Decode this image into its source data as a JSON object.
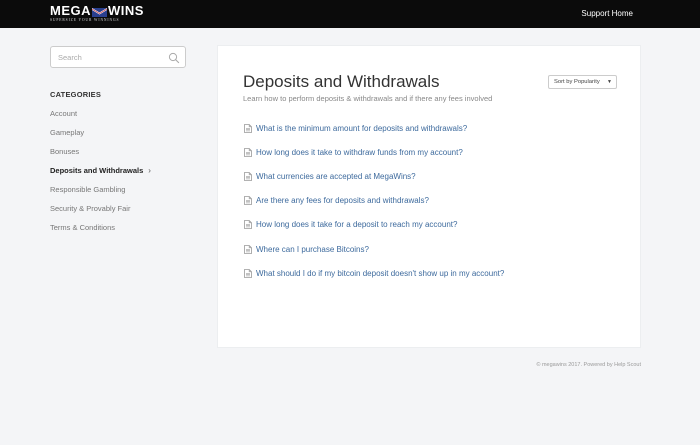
{
  "header": {
    "logo_left": "MEGA",
    "logo_right": "WINS",
    "logo_tagline": "SUPERSIZE YOUR WINNINGS",
    "support_link": "Support Home"
  },
  "sidebar": {
    "search_placeholder": "Search",
    "categories_heading": "CATEGORIES",
    "items": [
      {
        "label": "Account",
        "active": false
      },
      {
        "label": "Gameplay",
        "active": false
      },
      {
        "label": "Bonuses",
        "active": false
      },
      {
        "label": "Deposits and Withdrawals",
        "active": true
      },
      {
        "label": "Responsible Gambling",
        "active": false
      },
      {
        "label": "Security & Provably Fair",
        "active": false
      },
      {
        "label": "Terms & Conditions",
        "active": false
      }
    ]
  },
  "main": {
    "title": "Deposits and Withdrawals",
    "subtitle": "Learn how to perform deposits & withdrawals and if there any fees involved",
    "sort_label": "Sort by Popularity",
    "articles": [
      "What is the minimum amount for deposits and withdrawals?",
      "How long does it take to withdraw funds from my account?",
      "What currencies are accepted at MegaWins?",
      "Are there any fees for deposits and withdrawals?",
      "How long does it take for a deposit to reach my account?",
      "Where can I purchase Bitcoins?",
      "What should I do if my bitcoin deposit doesn't show up in my account?"
    ]
  },
  "footer": {
    "text": "© megawins 2017. Powered by Help Scout"
  },
  "colors": {
    "topbar": "#0b0b0b",
    "link": "#3d6a9d",
    "background": "#f4f5f7",
    "flag_blue": "#2a3f8f",
    "flag_red": "#c0272d"
  },
  "icons": {
    "search": "search-icon",
    "article": "document-icon",
    "active_category": "chevron-right-icon",
    "sort": "caret-down-icon"
  }
}
